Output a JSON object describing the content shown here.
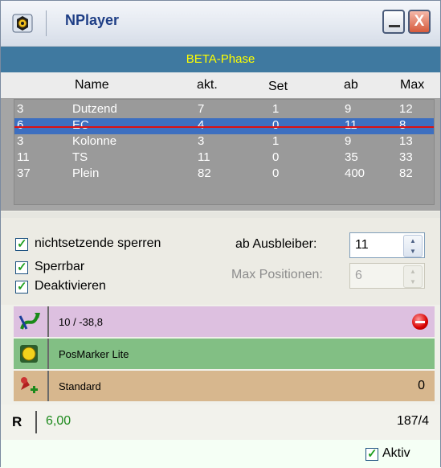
{
  "window": {
    "title": "NPlayer",
    "minimize_icon": "minimize-icon",
    "close_label": "X"
  },
  "phase": "BETA-Phase",
  "table": {
    "columns": [
      "Name",
      "akt.",
      "Set",
      "ab",
      "Max"
    ],
    "rows": [
      {
        "id": "3",
        "name": "Dutzend",
        "akt": "7",
        "set": "1",
        "ab": "9",
        "max": "12",
        "selected": false
      },
      {
        "id": "6",
        "name": "EC",
        "akt": "4",
        "set": "0",
        "ab": "11",
        "max": "8",
        "selected": true
      },
      {
        "id": "3",
        "name": "Kolonne",
        "akt": "3",
        "set": "1",
        "ab": "9",
        "max": "13",
        "selected": false
      },
      {
        "id": "11",
        "name": "TS",
        "akt": "11",
        "set": "0",
        "ab": "35",
        "max": "33",
        "selected": false
      },
      {
        "id": "37",
        "name": "Plein",
        "akt": "82",
        "set": "0",
        "ab": "400",
        "max": "82",
        "selected": false
      }
    ]
  },
  "options": {
    "checkbox1": "nichtsetzende sperren",
    "checkbox2": "Sperrbar",
    "checkbox3": "Deaktivieren",
    "ausbleiber_label": "ab Ausbleiber:",
    "ausbleiber_value": "11",
    "maxpos_label": "Max Positionen:",
    "maxpos_value": "6"
  },
  "bands": {
    "band1": {
      "text": "10 / -38,8",
      "icon": "progression-icon",
      "status_icon": "stop-icon"
    },
    "band2": {
      "text": "PosMarker Lite",
      "icon": "yellow-circle-icon"
    },
    "band3": {
      "text": "Standard",
      "value": "0",
      "icon": "strategy-icon"
    }
  },
  "footer": {
    "r_label": "R",
    "r_value": "6,00",
    "count": "187/4",
    "aktiv_label": "Aktiv"
  },
  "colors": {
    "accent": "#3f79a0",
    "phase_text": "#ffff00",
    "selection": "#3d6fc0",
    "band1": "#ddc0e0",
    "band2": "#82bf84",
    "band3": "#d7b78e"
  }
}
